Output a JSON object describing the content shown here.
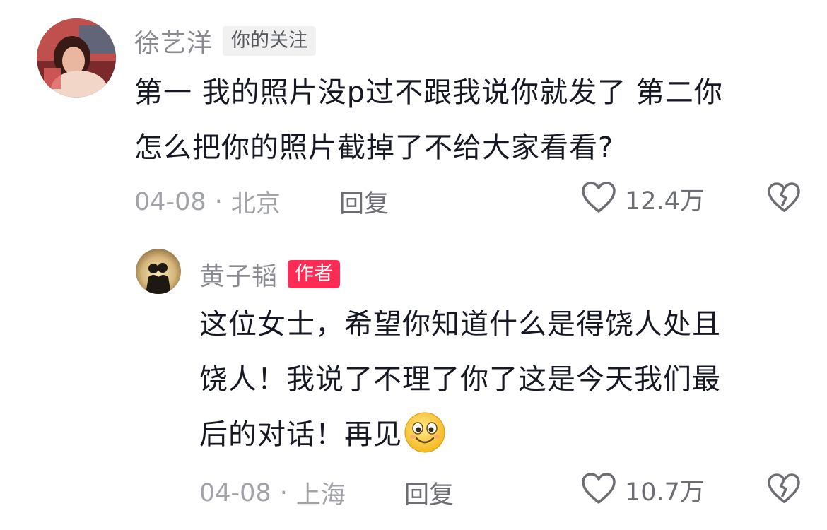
{
  "comments": [
    {
      "username": "徐艺洋",
      "tag": "你的关注",
      "text_lines": [
        "第一 我的照片没p过不跟我说你就发了 第二你",
        "怎么把你的照片截掉了不给大家看看?"
      ],
      "date": "04-08",
      "separator": "·",
      "location": "北京",
      "reply_label": "回复",
      "likes": "12.4万",
      "icons": {
        "like": "heart-outline-icon",
        "dislike": "broken-heart-icon"
      }
    },
    {
      "username": "黄子韬",
      "tag": "作者",
      "text_lines": [
        "这位女士，希望你知道什么是得饶人处且",
        "饶人！我说了不理了你了这是今天我们最",
        "后的对话！再见"
      ],
      "emoji": "smiling-emoji",
      "date": "04-08",
      "separator": "·",
      "location": "上海",
      "reply_label": "回复",
      "likes": "10.7万",
      "icons": {
        "like": "heart-outline-icon",
        "dislike": "broken-heart-icon"
      }
    }
  ],
  "colors": {
    "text": "#161823",
    "muted": "#a2a3a8",
    "author_tag": "#fe2c55",
    "follow_tag_bg": "#f1f1f2"
  }
}
